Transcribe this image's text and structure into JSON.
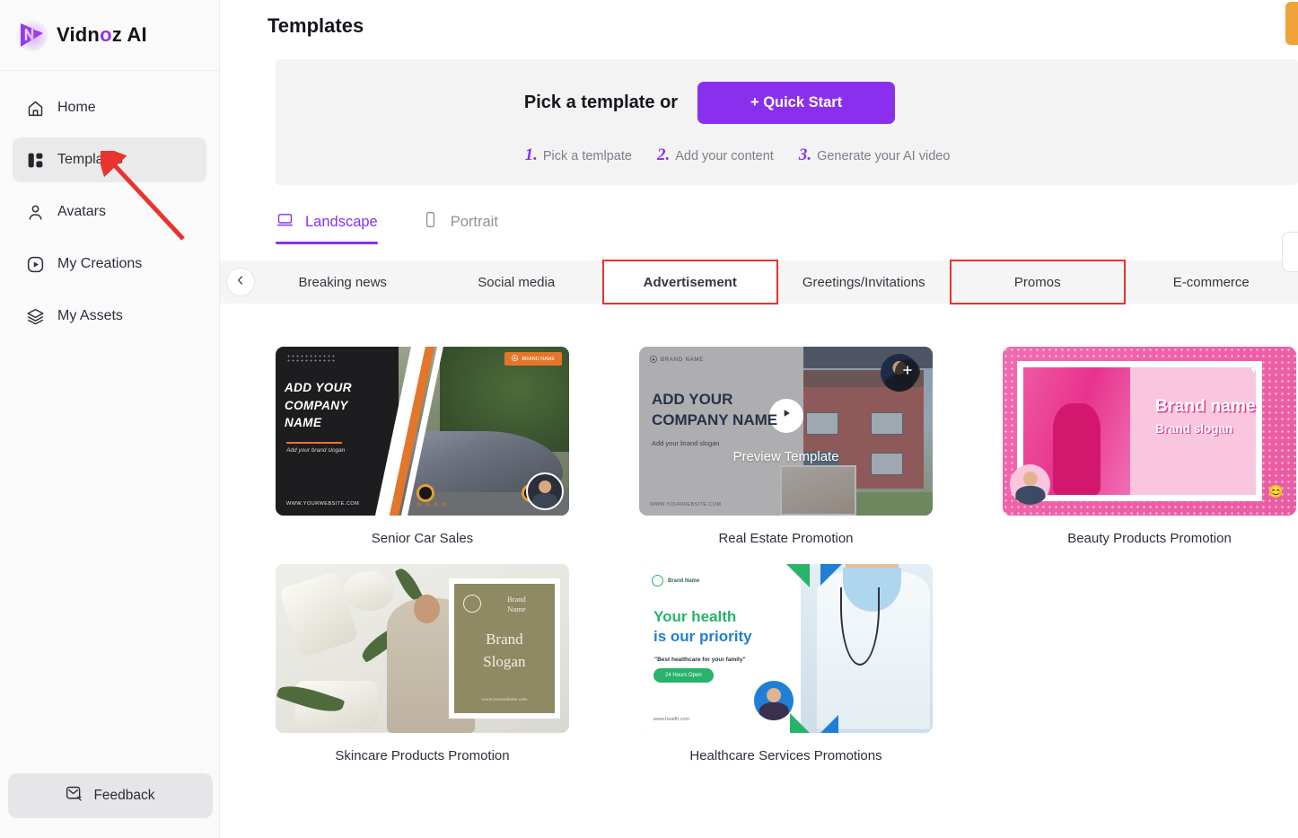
{
  "brand": {
    "name_prefix": "Vidn",
    "name_accent": "o",
    "name_suffix": "z AI",
    "logo_icon": "vidnoz-logo-icon"
  },
  "sidebar": {
    "items": [
      {
        "label": "Home",
        "icon": "home-icon",
        "active": false
      },
      {
        "label": "Templates",
        "icon": "templates-grid-icon",
        "active": true
      },
      {
        "label": "Avatars",
        "icon": "user-icon",
        "active": false
      },
      {
        "label": "My Creations",
        "icon": "play-circle-icon",
        "active": false
      },
      {
        "label": "My Assets",
        "icon": "layers-icon",
        "active": false
      }
    ],
    "feedback": {
      "label": "Feedback",
      "icon": "feedback-envelope-icon"
    }
  },
  "header": {
    "title": "Templates"
  },
  "hero": {
    "headline": "Pick a template or",
    "quick_start_label": "+ Quick Start",
    "steps": [
      {
        "num": "1.",
        "label": "Pick a temlpate"
      },
      {
        "num": "2.",
        "label": "Add your content"
      },
      {
        "num": "3.",
        "label": "Generate your AI video"
      }
    ]
  },
  "view_tabs": [
    {
      "label": "Landscape",
      "icon": "laptop-icon",
      "active": true
    },
    {
      "label": "Portrait",
      "icon": "phone-icon",
      "active": false
    }
  ],
  "categories": {
    "prev_icon": "chevron-left-icon",
    "items": [
      {
        "label": "Breaking news",
        "selected": false,
        "highlighted": false
      },
      {
        "label": "Social media",
        "selected": false,
        "highlighted": false
      },
      {
        "label": "Advertisement",
        "selected": true,
        "highlighted": true
      },
      {
        "label": "Greetings/Invitations",
        "selected": false,
        "highlighted": false
      },
      {
        "label": "Promos",
        "selected": false,
        "highlighted": true
      },
      {
        "label": "E-commerce",
        "selected": false,
        "highlighted": false
      }
    ]
  },
  "templates": [
    {
      "title": "Senior Car Sales",
      "art": {
        "company": "ADD YOUR\nCOMPANY\nNAME",
        "slogan": "Add your brand slogan",
        "url": "WWW.YOURWEBSITE.COM",
        "badge": "BRAND NAME",
        "chevrons": "» » » »"
      },
      "hover": false
    },
    {
      "title": "Real Estate Promotion",
      "art": {
        "company": "ADD YOUR\nCOMPANY NAME",
        "slogan": "Add your brand slogan",
        "url": "WWW.YOURWEBSITE.COM",
        "badge": "BRAND NAME"
      },
      "hover": true,
      "overlay_label": "Preview Template",
      "play_icon": "play-icon",
      "add_icon": "plus-icon"
    },
    {
      "title": "Beauty Products Promotion",
      "art": {
        "brand": "Brand name",
        "slogan": "Brand slogan",
        "emoji": "😊",
        "heart": "♥"
      },
      "hover": false
    },
    {
      "title": "Skincare Products Promotion",
      "art": {
        "brand": "Brand\nName",
        "slogan": "Brand\nSlogan",
        "url": "www.yourwebsite.com"
      },
      "hover": false
    },
    {
      "title": "Healthcare Services Promotions",
      "art": {
        "brand": "Brand Name",
        "h1_a": "Your health",
        "h1_b": "is our priority",
        "quote": "\"Best healthcare for your family\"",
        "pill": "24 Hours Open",
        "url": "www.health.com"
      },
      "hover": false
    }
  ],
  "edge_widgets": [
    {
      "name": "orange-tab",
      "color": "#f0a338"
    },
    {
      "name": "side-panel-handle",
      "color": "#ffffff"
    }
  ],
  "annotation": {
    "name": "red-arrow-pointing-to-templates",
    "color": "#e8332f"
  },
  "colors": {
    "accent": "#8b2fef",
    "highlight_red": "#e8332f",
    "sidebar_bg": "#fafafa",
    "hero_bg": "#f3f3f3"
  }
}
